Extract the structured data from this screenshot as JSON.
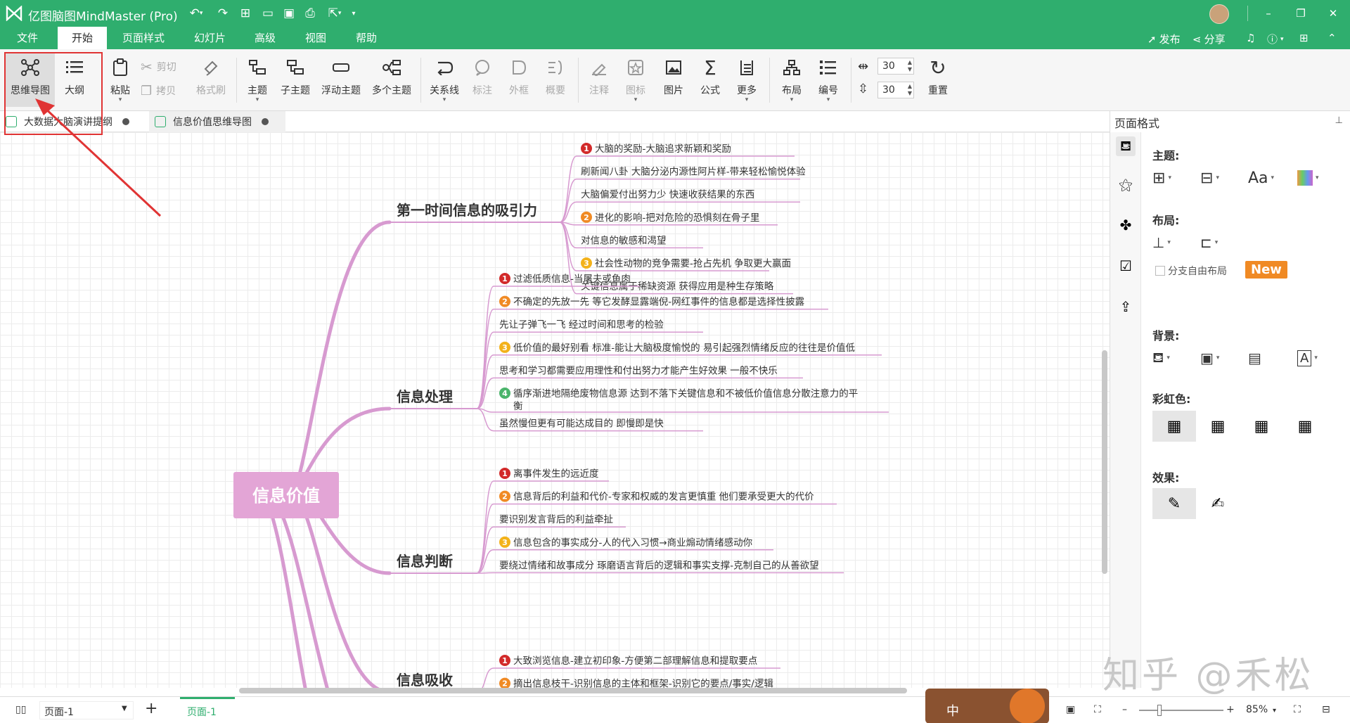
{
  "app": {
    "title": "亿图脑图MindMaster (Pro)",
    "user_avatar": "user-avatar"
  },
  "menu": {
    "items": [
      "文件",
      "开始",
      "页面样式",
      "幻灯片",
      "高级",
      "视图",
      "帮助"
    ],
    "active": "开始",
    "publish": "发布",
    "share": "分享"
  },
  "ribbon": {
    "mindmap": "思维导图",
    "outline": "大纲",
    "paste": "粘贴",
    "cut": "剪切",
    "copy": "拷贝",
    "format_painter": "格式刷",
    "topic": "主题",
    "subtopic": "子主题",
    "floating": "浮动主题",
    "multi": "多个主题",
    "relation": "关系线",
    "callout": "标注",
    "boundary": "外框",
    "summary": "概要",
    "note": "注释",
    "icon": "图标",
    "image": "图片",
    "formula": "公式",
    "more": "更多",
    "layout": "布局",
    "numbering": "编号",
    "spacing_h": "30",
    "spacing_v": "30",
    "reset": "重置"
  },
  "tabs": [
    {
      "label": "大数据大脑演讲提纲",
      "active": false
    },
    {
      "label": "信息价值思维导图",
      "active": true
    }
  ],
  "mindmap": {
    "central": "信息价值",
    "branches": [
      {
        "title": "第一时间信息的吸引力",
        "items": [
          {
            "num": "1",
            "text": "大脑的奖励-大脑追求新颖和奖励"
          },
          {
            "num": "",
            "text": "刷新闻八卦 大脑分泌内源性阿片样-带来轻松愉悦体验"
          },
          {
            "num": "",
            "text": "大脑偏爱付出努力少 快速收获结果的东西"
          },
          {
            "num": "2",
            "text": "进化的影响-把对危险的恐惧刻在骨子里"
          },
          {
            "num": "",
            "text": "对信息的敏感和渴望"
          },
          {
            "num": "3",
            "text": "社会性动物的竞争需要-抢占先机 争取更大赢面"
          },
          {
            "num": "",
            "text": "关键信息属于稀缺资源 获得应用是种生存策略"
          }
        ]
      },
      {
        "title": "信息处理",
        "items": [
          {
            "num": "1",
            "text": "过滤低质信息-当屠夫或鱼肉"
          },
          {
            "num": "2",
            "text": "不确定的先放一先 等它发酵显露端倪-网红事件的信息都是选择性披露"
          },
          {
            "num": "",
            "text": "先让子弹飞一飞 经过时间和思考的检验"
          },
          {
            "num": "3",
            "text": "低价值的最好别看 标准-能让大脑极度愉悦的 易引起强烈情绪反应的往往是价值低"
          },
          {
            "num": "",
            "text": "思考和学习都需要应用理性和付出努力才能产生好效果 一般不快乐"
          },
          {
            "num": "4",
            "text": "循序渐进地隔绝废物信息源 达到不落下关键信息和不被低价值信息分散注意力的平",
            "text2": "衡"
          },
          {
            "num": "",
            "text": "虽然慢但更有可能达成目的 即慢即是快"
          }
        ]
      },
      {
        "title": "信息判断",
        "items": [
          {
            "num": "1",
            "text": "离事件发生的远近度"
          },
          {
            "num": "2",
            "text": "信息背后的利益和代价-专家和权威的发言更慎重 他们要承受更大的代价"
          },
          {
            "num": "",
            "text": "要识别发言背后的利益牵扯"
          },
          {
            "num": "3",
            "text": "信息包含的事实成分-人的代入习惯→商业煽动情绪感动你"
          },
          {
            "num": "",
            "text": "要绕过情绪和故事成分 琢磨语言背后的逻辑和事实支撑-克制自己的从善欲望"
          }
        ]
      },
      {
        "title": "信息吸收",
        "items": [
          {
            "num": "1",
            "text": "大致浏览信息-建立初印象-方便第二部理解信息和提取要点"
          },
          {
            "num": "2",
            "text": "摘出信息枝干-识别信息的主体和框架-识别它的要点/事实/逻辑"
          }
        ]
      }
    ]
  },
  "sidebar": {
    "title": "页面格式",
    "sections": {
      "theme": "主题:",
      "layout": "布局:",
      "free_layout": "分支自由布局",
      "new_badge": "New",
      "background": "背景:",
      "rainbow": "彩虹色:",
      "effect": "效果:"
    }
  },
  "status": {
    "page_selector": "页面-1",
    "page_tab": "页面-1",
    "zoom": "85%",
    "ime": "中"
  },
  "watermark": "知乎 @禾松",
  "colors": {
    "brand_green": "#2fae6e",
    "branch": "#d79ad0",
    "central_fill": "#e3a5d6",
    "num1": "#d22a2a",
    "num2": "#f08a24",
    "num3": "#f3b21a",
    "num4": "#4bb46b",
    "annotation_red": "#e03434"
  }
}
